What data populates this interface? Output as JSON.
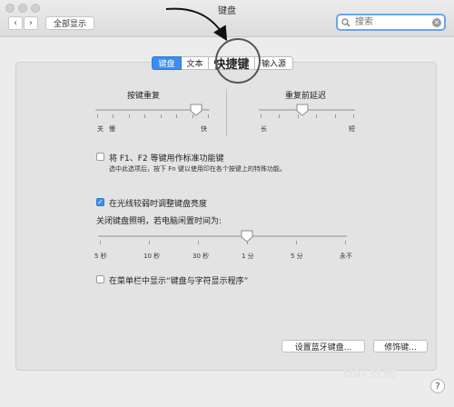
{
  "window": {
    "title": "键盘"
  },
  "toolbar": {
    "back": "‹",
    "forward": "›",
    "show_all": "全部显示"
  },
  "search": {
    "placeholder": "搜索",
    "clear": "×"
  },
  "tabs": [
    {
      "label": "键盘",
      "active": true
    },
    {
      "label": "文本",
      "active": false
    },
    {
      "label": "快捷键",
      "active": false
    },
    {
      "label": "输入源",
      "active": false
    }
  ],
  "key_repeat": {
    "title": "按键重复",
    "left_label": "关",
    "left2_label": "慢",
    "right_label": "快",
    "level": 0.88
  },
  "repeat_delay": {
    "title": "重复前延迟",
    "left_label": "长",
    "right_label": "短",
    "level": 0.45
  },
  "fn_keys": {
    "checked": false,
    "label": "将 F1、F2 等键用作标准功能键",
    "hint": "选中此选项后，按下 Fn 键以使用印在各个按键上的特殊功能。"
  },
  "brightness": {
    "checked": true,
    "check_mark": "✓",
    "label": "在光线较弱时调整键盘亮度"
  },
  "backlight": {
    "title": "关闭键盘照明，若电脑闲置时间为:",
    "ticks": [
      "5 秒",
      "10 秒",
      "30 秒",
      "1 分",
      "5 分",
      "永不"
    ],
    "selected_index": 3
  },
  "menu_bar": {
    "checked": false,
    "label": "在菜单栏中显示“键盘与字符显示程序”"
  },
  "buttons": {
    "bluetooth": "设置蓝牙键盘...",
    "modifier": "修饰键..."
  },
  "help": "?",
  "watermark": "Bai 经验"
}
